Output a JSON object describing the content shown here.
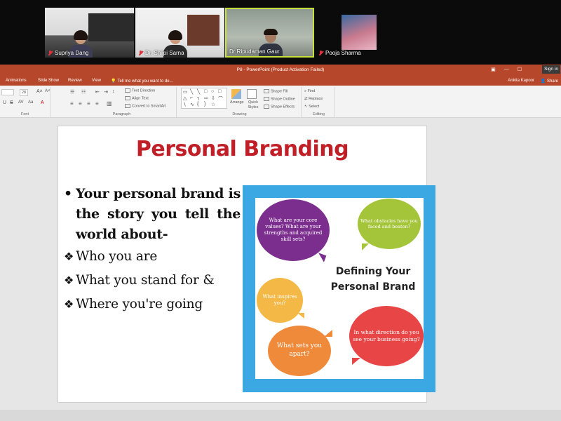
{
  "video_participants": [
    {
      "name": "Supriya Dang"
    },
    {
      "name": "Dr. Shilpi Sarna"
    },
    {
      "name": "Dr Ripudaman Gaur"
    },
    {
      "name": "Pooja Sharma"
    }
  ],
  "titlebar": {
    "title": "P8 - PowerPoint (Product Activation Failed)",
    "sign_in": "Sign in"
  },
  "ribbon_tabs": {
    "animations": "Animations",
    "slide_show": "Slide Show",
    "review": "Review",
    "view": "View",
    "tell_me": "Tell me what you want to do...",
    "user": "Ankita Kapoor",
    "share": "Share"
  },
  "ribbon": {
    "font_size": "28",
    "font_label": "Font",
    "paragraph_label": "Paragraph",
    "drawing_label": "Drawing",
    "editing_label": "Editing",
    "text_direction": "Text Direction",
    "align_text": "Align Text",
    "convert_smartart": "Convert to SmartArt",
    "arrange": "Arrange",
    "quick_styles": "Quick Styles",
    "shape_fill": "Shape Fill",
    "shape_outline": "Shape Outline",
    "shape_effects": "Shape Effects",
    "find": "Find",
    "replace": "Replace",
    "select": "Select"
  },
  "slide": {
    "title": "Personal Branding",
    "main_bullet": "Your personal brand is the story you tell the world about-",
    "sub_items": [
      "Who you are",
      "What you stand for &",
      "Where you're going"
    ],
    "infographic": {
      "title_line1": "Defining Your",
      "title_line2": "Personal Brand",
      "bubbles": {
        "purple": "What are your core values? What are your strengths and acquired skill sets?",
        "green": "What obstacles have you faced and beaten?",
        "yellow": "What inspires you?",
        "orange": "What sets you apart?",
        "red": "In what direction do you see your business going?"
      }
    }
  },
  "colors": {
    "ppt_accent": "#b7472a",
    "slide_title": "#c01f27",
    "infographic_frame": "#3ba7e3",
    "bubble_purple": "#7b2e8e",
    "bubble_green": "#a4c43a",
    "bubble_yellow": "#f3b845",
    "bubble_orange": "#f08a3b",
    "bubble_red": "#e84547",
    "active_speaker_border": "#c7e13a"
  }
}
